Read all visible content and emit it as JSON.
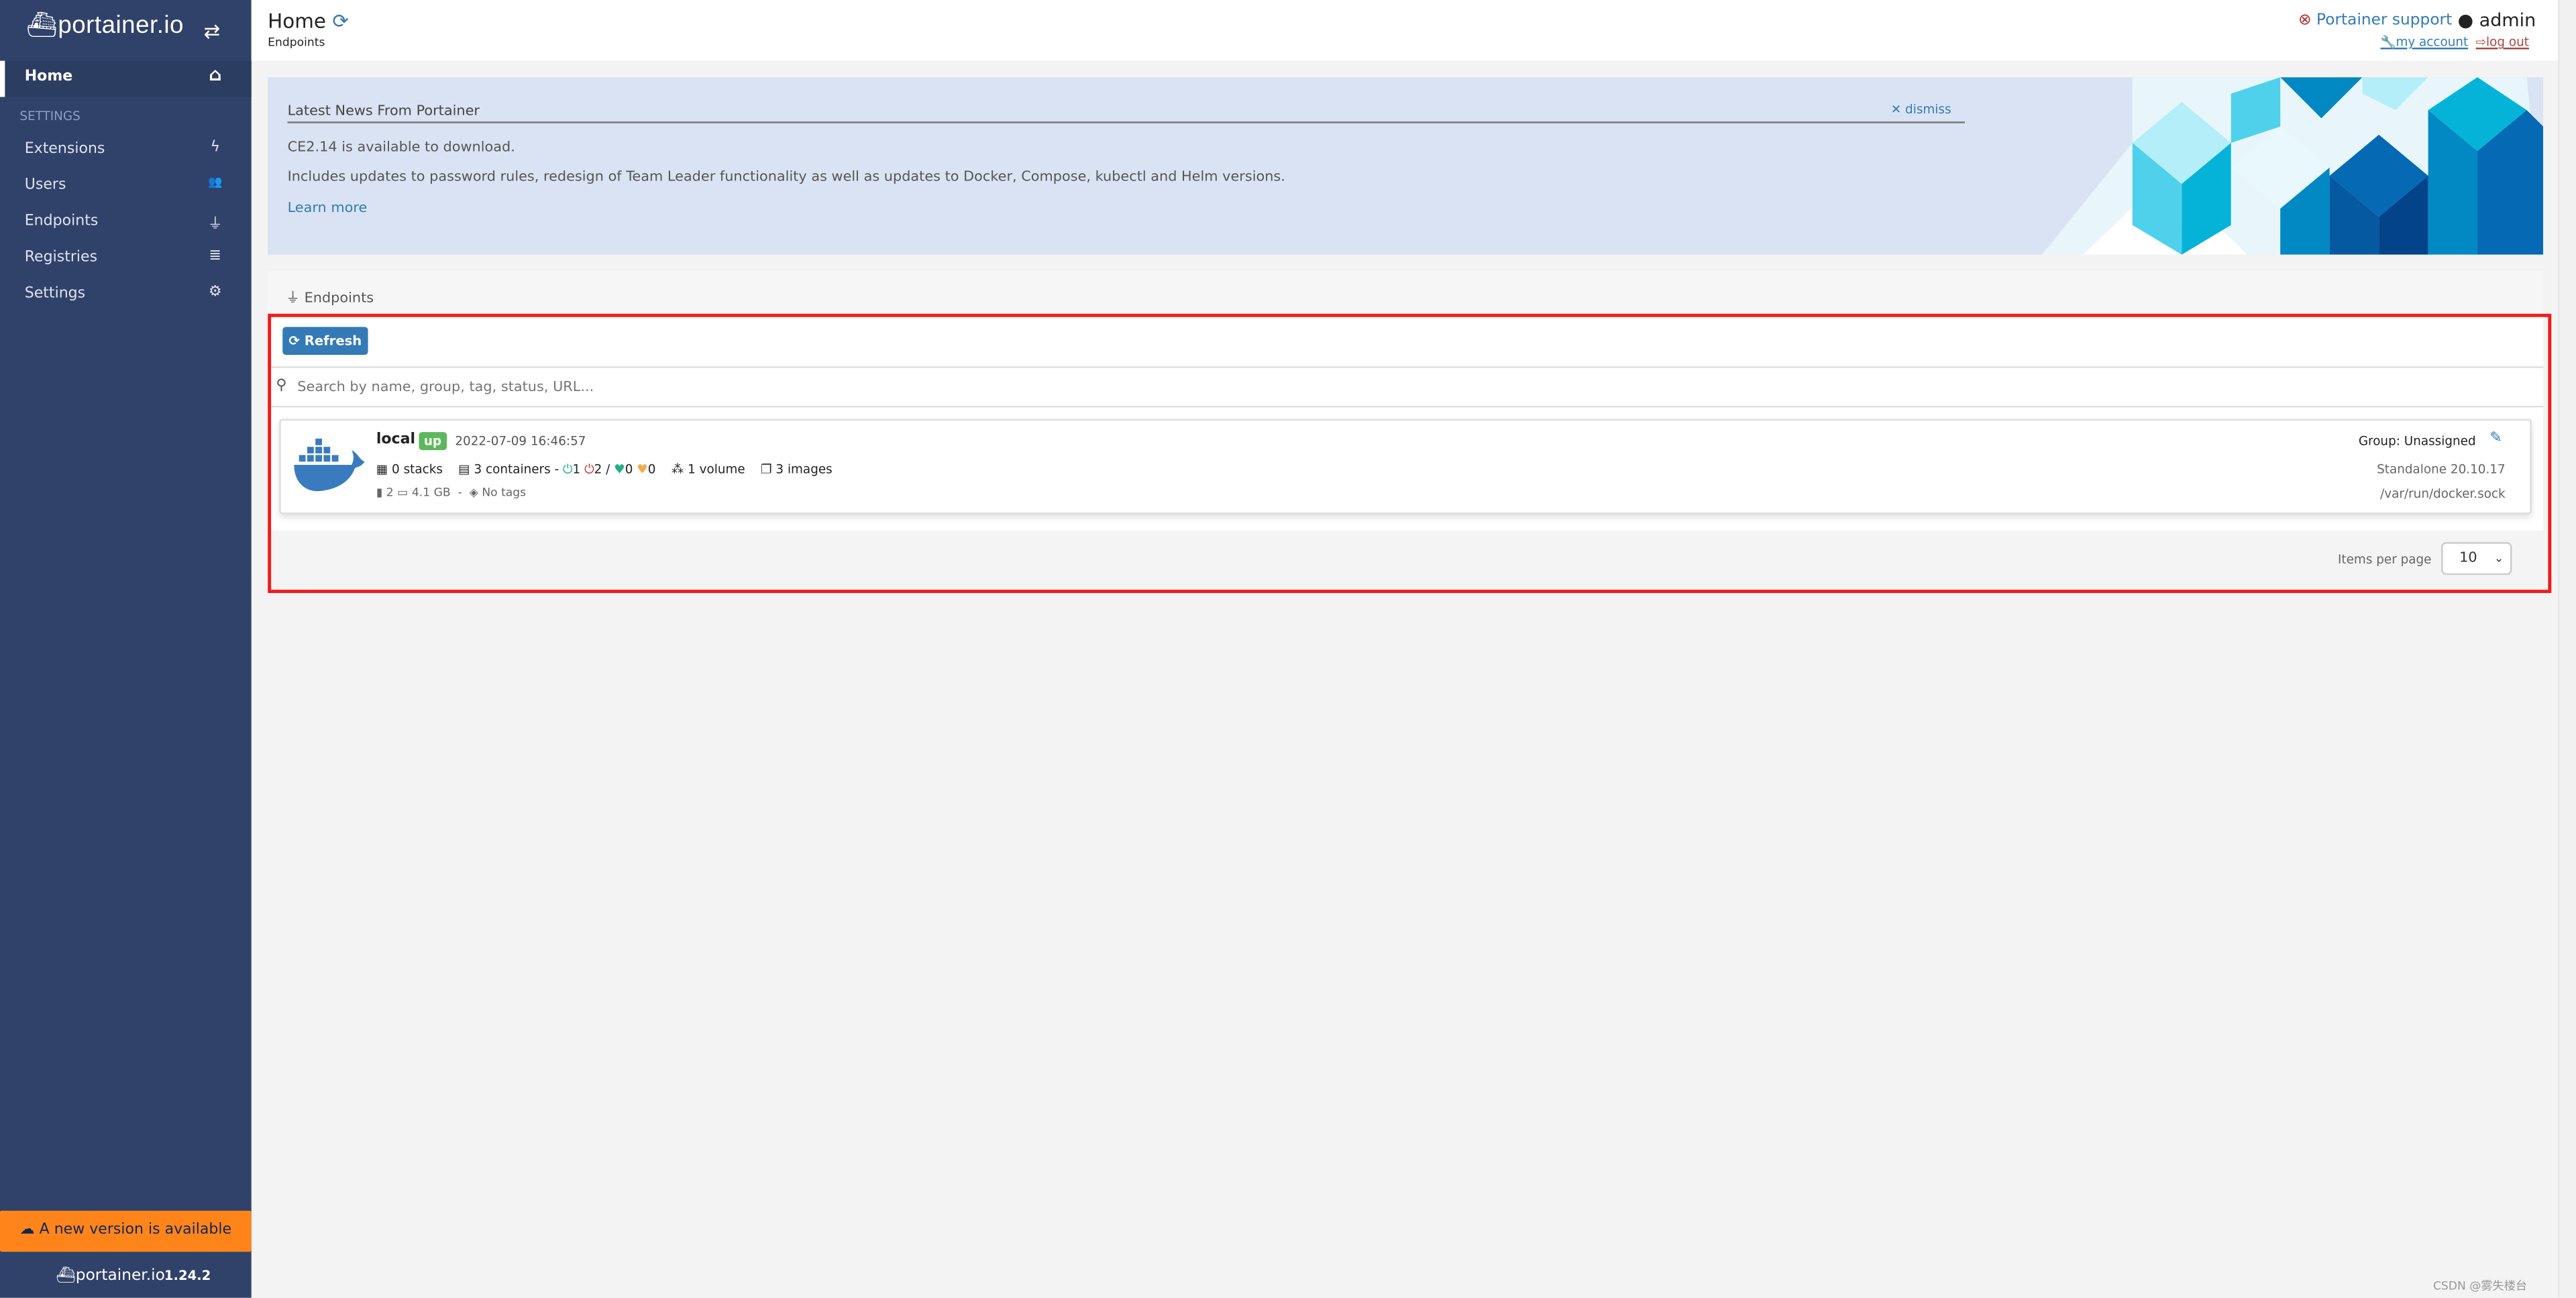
{
  "sidebar": {
    "brand": "portainer.io",
    "items": [
      {
        "label": "Home",
        "icon": "home-icon",
        "glyph": "⌂"
      },
      {
        "label": "Extensions",
        "icon": "bolt-icon",
        "glyph": "ϟ"
      },
      {
        "label": "Users",
        "icon": "users-icon",
        "glyph": "👥"
      },
      {
        "label": "Endpoints",
        "icon": "plug-icon",
        "glyph": "⏚"
      },
      {
        "label": "Registries",
        "icon": "database-icon",
        "glyph": "≣"
      },
      {
        "label": "Settings",
        "icon": "cogs-icon",
        "glyph": "⚙"
      }
    ],
    "section_label": "SETTINGS",
    "new_version": "A new version is available",
    "footer_brand": "portainer.io",
    "version": "1.24.2"
  },
  "header": {
    "title": "Home",
    "breadcrumb": "Endpoints",
    "support": "Portainer support",
    "user": "admin",
    "my_account": "my account",
    "log_out": "log out"
  },
  "news": {
    "title": "Latest News From Portainer",
    "dismiss": "dismiss",
    "line1": "CE2.14 is available to download.",
    "line2": "Includes updates to password rules, redesign of Team Leader functionality as well as updates to Docker, Compose, kubectl and Helm versions.",
    "learn_more": "Learn more"
  },
  "endpoints": {
    "title": "Endpoints",
    "refresh": "Refresh",
    "search_placeholder": "Search by name, group, tag, status, URL...",
    "items": [
      {
        "name": "local",
        "status": "up",
        "timestamp": "2022-07-09 16:46:57",
        "stacks": "0 stacks",
        "containers": "3 containers -",
        "running": "1",
        "stopped": "2 /",
        "healthy": "0",
        "unhealthy": "0",
        "volumes": "1 volume",
        "images": "3 images",
        "cpu": "2",
        "memory": "4.1 GB",
        "tags": "No tags",
        "group": "Group: Unassigned",
        "type": "Standalone 20.10.17",
        "url": "/var/run/docker.sock"
      }
    ],
    "items_per_page_label": "Items per page",
    "items_per_page": "10"
  },
  "colors": {
    "sidebar": "#30426a",
    "accent": "#337ab7",
    "up": "#5cb85c",
    "new_version": "#ff851b",
    "highlight": "#f21b1b"
  },
  "watermark": "CSDN @雾失楼台"
}
